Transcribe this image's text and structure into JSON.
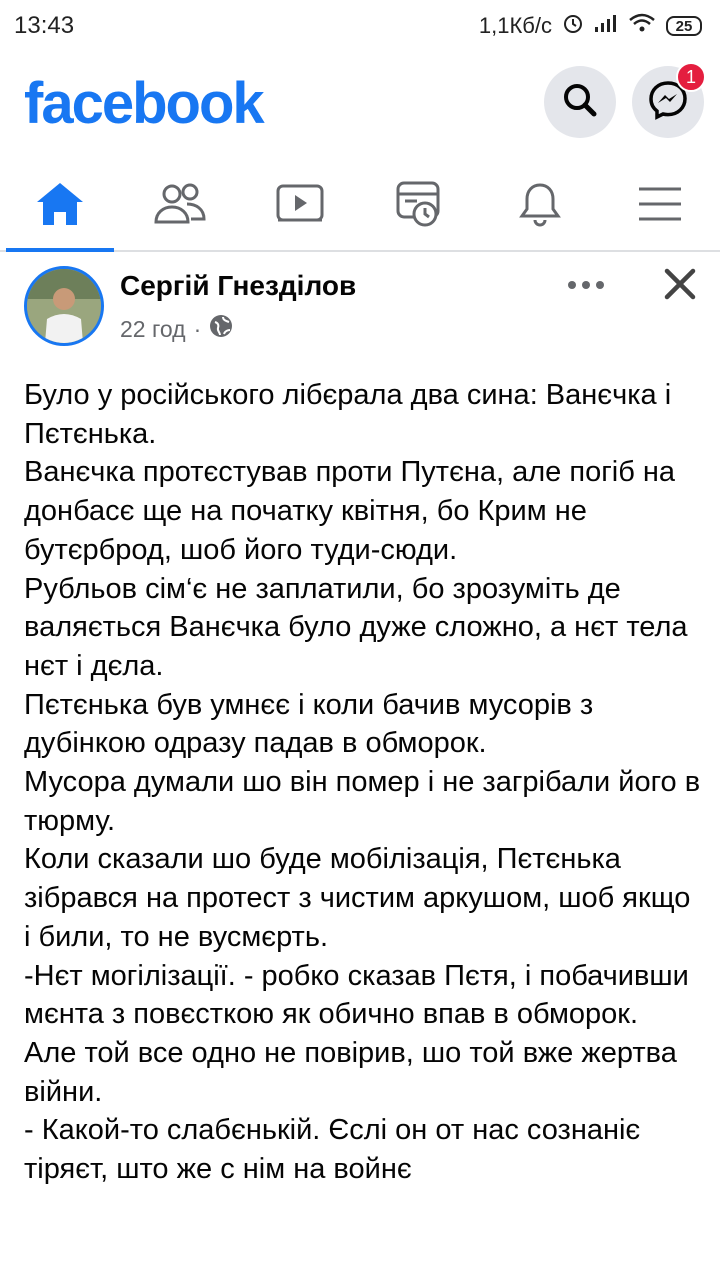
{
  "status_bar": {
    "time": "13:43",
    "network_speed": "1,1Кб/с",
    "battery": "25"
  },
  "header": {
    "logo": "facebook",
    "search_icon": "search-icon",
    "messenger_icon": "messenger-icon",
    "messenger_badge": "1"
  },
  "tabs": [
    {
      "icon": "home-icon",
      "active": true
    },
    {
      "icon": "friends-icon",
      "active": false
    },
    {
      "icon": "watch-icon",
      "active": false
    },
    {
      "icon": "news-icon",
      "active": false
    },
    {
      "icon": "bell-icon",
      "active": false
    },
    {
      "icon": "menu-icon",
      "active": false
    }
  ],
  "post": {
    "author": "Сергій Гнезділов",
    "time": "22 год",
    "separator": "·",
    "privacy_icon": "globe-icon",
    "lines": [
      "Було у російського лібєрала два сина: Ванєчка і Пєтєнька.",
      "Ванєчка протєстував проти Путєна, але погіб на донбасє ще на початку квітня, бо Крим не бутєрброд, шоб його туди-сюди.",
      "Рубльов сім‘є не заплатили, бо зрозуміть де валяється Ванєчка було дуже сложно, а нєт тела нєт і дєла.",
      "Пєтєнька був умнєє і коли бачив мусорів з дубінкою одразу падав в обморок.",
      "Мусора думали шо він помер і не загрібали його в тюрму.",
      "Коли сказали шо буде мобілізація, Пєтєнька зібрався на протест з чистим аркушом, шоб якщо і били, то не вусмєрть.",
      "-Нєт могілізації. - робко сказав Пєтя, і побачивши мєнта з повєсткою як обично впав в обморок.",
      "Але той все одно не повірив, шо той вже жертва війни.",
      "- Какой-то слабєнькій. Єслі он от нас сознаніє тіряєт, што же с нім на войнє"
    ]
  }
}
